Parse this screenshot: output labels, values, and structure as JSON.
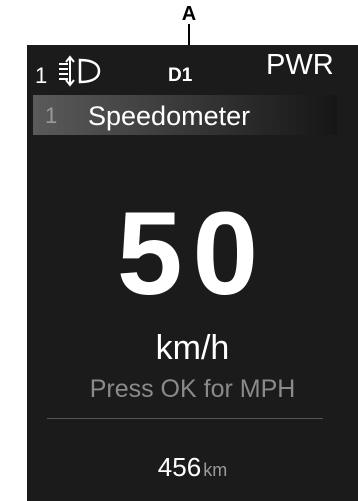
{
  "callout": {
    "label": "A"
  },
  "status_bar": {
    "beam_level": "1",
    "headlight_icon": "headlight-leveling-icon",
    "gear": "D1",
    "drive_mode": "PWR"
  },
  "menu": {
    "index": "1",
    "title": "Speedometer"
  },
  "speed": {
    "value": "50",
    "unit": "km/h",
    "hint": "Press OK for MPH"
  },
  "odometer": {
    "value": "456",
    "unit": "km"
  },
  "colors": {
    "screen_bg": "#1b1b1b",
    "text": "#ffffff",
    "muted": "#8a8a8a"
  }
}
